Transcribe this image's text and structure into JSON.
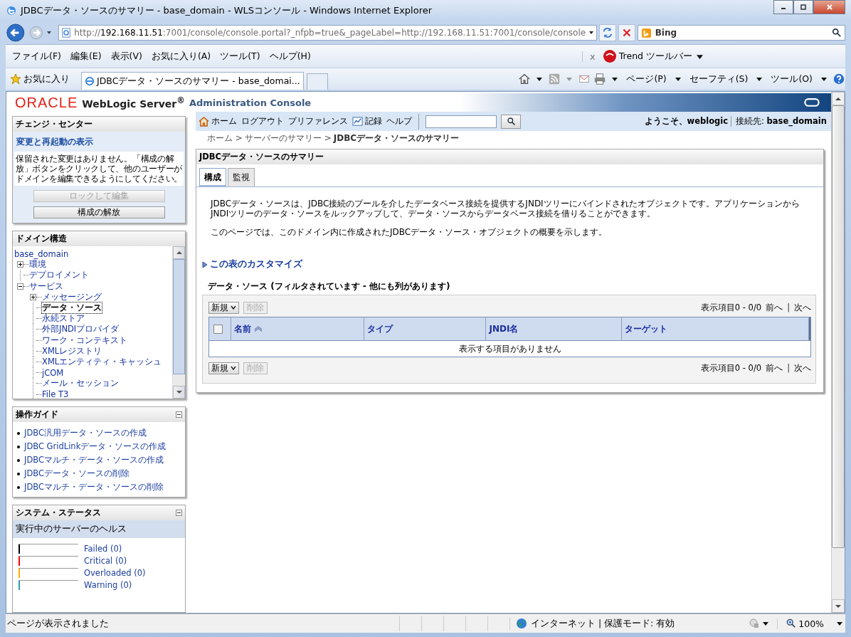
{
  "window": {
    "title": "JDBCデータ・ソースのサマリー - base_domain - WLSコンソール - Windows Internet Explorer"
  },
  "address_bar": {
    "url_parts": [
      {
        "text": "http://",
        "host": false
      },
      {
        "text": "192.168.11.51",
        "host": true
      },
      {
        "text": ":7001/console/console.portal?_nfpb=true&_pageLabel=http://192.168.11.51:7001/console/console",
        "host": false
      }
    ]
  },
  "search": {
    "placeholder": "Bing"
  },
  "menu": [
    "ファイル(F)",
    "編集(E)",
    "表示(V)",
    "お気に入り(A)",
    "ツール(T)",
    "ヘルプ(H)"
  ],
  "toolbar": {
    "close": "x",
    "trend": "Trend ツールバー"
  },
  "favorites": {
    "label": "お気に入り"
  },
  "tabs": [
    {
      "label": "JDBCデータ・ソースのサマリー - base_domai...",
      "selected": true
    }
  ],
  "command_bar": [
    "ページ(P)",
    "セーフティ(S)",
    "ツール(O)"
  ],
  "console_header": {
    "brand": "ORACLE",
    "product": "WebLogic Server$^{®}$",
    "subtitle": "Administration Console"
  },
  "change_center": {
    "title": "チェンジ・センター",
    "link": "変更と再起動の表示",
    "message": "保留された変更はありません。「構成の解放」ボタンをクリックして、他のユーザーがドメインを編集できるようにしてください。",
    "buttons": [
      {
        "label": "ロックして編集",
        "disabled": true
      },
      {
        "label": "構成の解放",
        "disabled": false
      }
    ]
  },
  "domain_structure": {
    "title": "ドメイン構造",
    "tree": [
      {
        "label": "base_domain",
        "selected": false,
        "children": [
          {
            "label": "環境",
            "selected": false,
            "expanded": false
          },
          {
            "label": "デプロイメント",
            "selected": false
          },
          {
            "label": "サービス",
            "selected": false,
            "expanded": true,
            "children": [
              {
                "label": "メッセージング",
                "selected": false,
                "expanded": false
              },
              {
                "label": "データ・ソース",
                "selected": true
              },
              {
                "label": "永続ストア",
                "selected": false
              },
              {
                "label": "外部JNDIプロバイダ",
                "selected": false
              },
              {
                "label": "ワーク・コンテキスト",
                "selected": false
              },
              {
                "label": "XMLレジストリ",
                "selected": false
              },
              {
                "label": "XMLエンティティ・キャッシュ",
                "selected": false
              },
              {
                "label": "jCOM",
                "selected": false
              },
              {
                "label": "メール・セッション",
                "selected": false
              },
              {
                "label": "File T3",
                "selected": false
              }
            ]
          }
        ]
      }
    ]
  },
  "guide": {
    "title": "操作ガイド",
    "links": [
      "JDBC汎用データ・ソースの作成",
      "JDBC GridLinkデータ・ソースの作成",
      "JDBCマルチ・データ・ソースの作成",
      "JDBCデータ・ソースの削除",
      "JDBCマルチ・データ・ソースの削除"
    ]
  },
  "system_status": {
    "title": "システム・ステータス",
    "subtitle": "実行中のサーバーのヘルス",
    "items": [
      {
        "label": "Failed (0)",
        "color": "#000000"
      },
      {
        "label": "Critical (0)",
        "color": "#ff0000"
      },
      {
        "label": "Overloaded (0)",
        "color": "#ffb000"
      },
      {
        "label": "Warning (0)",
        "color": "#2a9bb0"
      }
    ]
  },
  "nav": {
    "links": [
      {
        "label": "ホーム",
        "kind": "home"
      },
      {
        "label": "ログアウト",
        "kind": "plain"
      },
      {
        "label": "プリファレンス",
        "kind": "plain"
      },
      {
        "label": "記録",
        "kind": "record"
      },
      {
        "label": "ヘルプ",
        "kind": "plain"
      }
    ],
    "welcome": "ようこそ、weblogic",
    "connection": "接続先: **base_domain**"
  },
  "breadcrumb": [
    "ホーム >",
    "サーバーのサマリー >",
    "JDBCデータ・ソースのサマリー"
  ],
  "panel": {
    "title": "JDBCデータ・ソースのサマリー",
    "tabs": [
      {
        "label": "構成",
        "selected": true
      },
      {
        "label": "監視",
        "selected": false
      }
    ],
    "description": [
      "JDBCデータ・ソースは、JDBC接続のプールを介したデータベース接続を提供するJNDIツリーにバインドされたオブジェクトです。アプリケーションからJNDIツリーのデータ・ソースをルックアップして、データ・ソースからデータベース接続を借りることができます。",
      "このページでは、このドメイン内に作成されたJDBCデータ・ソース・オブジェクトの概要を示します。"
    ],
    "customize": "この表のカスタマイズ",
    "table": {
      "title": "データ・ソース (フィルタされています - 他にも列があります)",
      "toolbars": [
        {
          "new": "新規",
          "delete": "削除",
          "delete_disabled": true,
          "range": "表示項目0 - 0/0",
          "prev": "前へ",
          "separator": "|",
          "next": "次へ"
        },
        {
          "new": "新規",
          "delete": "削除",
          "delete_disabled": true,
          "range": "表示項目0 - 0/0",
          "prev": "前へ",
          "separator": "|",
          "next": "次へ"
        }
      ],
      "select_all_checked": false,
      "columns": [
        {
          "label": "名前",
          "sorted": true
        },
        {
          "label": "タイプ",
          "sorted": false
        },
        {
          "label": "JNDI名",
          "sorted": false
        },
        {
          "label": "ターゲット",
          "sorted": false
        }
      ],
      "empty_message": "表示する項目がありません"
    }
  },
  "status_bar": {
    "message": "ページが表示されました",
    "zone": "インターネット | 保護モード: 有効",
    "zoom": "100%"
  }
}
